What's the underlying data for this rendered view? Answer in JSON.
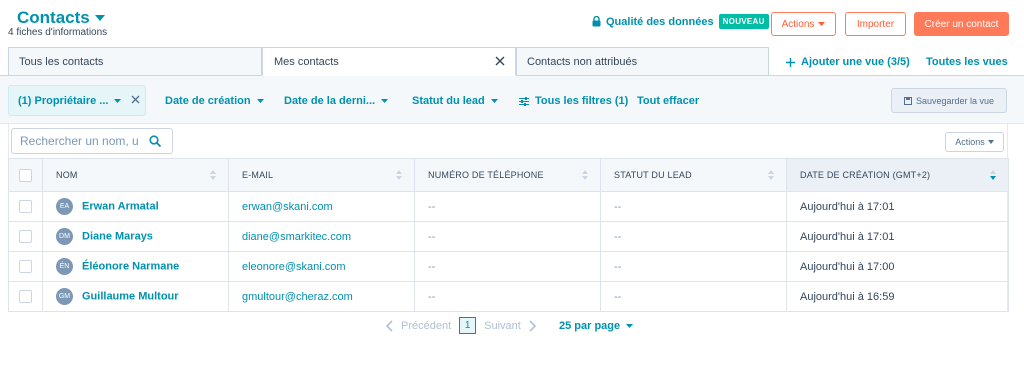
{
  "header": {
    "title": "Contacts",
    "subtitle": "4 fiches d'informations",
    "data_quality": "Qualité des données",
    "new_badge": "NOUVEAU",
    "actions_label": "Actions",
    "import_label": "Importer",
    "create_label": "Créer un contact"
  },
  "tabs": [
    {
      "label": "Tous les contacts"
    },
    {
      "label": "Mes contacts",
      "active": true
    },
    {
      "label": "Contacts non attribués"
    }
  ],
  "views": {
    "add_view": "Ajouter une vue (3/5)",
    "all_views": "Toutes les vues"
  },
  "filters": {
    "owner": "(1) Propriétaire ...",
    "created": "Date de création",
    "last": "Date de la derni...",
    "lead_status": "Statut du lead",
    "all_filters": "Tous les filtres (1)",
    "clear_all": "Tout effacer",
    "save_view": "Sauvegarder la vue"
  },
  "search": {
    "placeholder": "Rechercher un nom, u"
  },
  "table": {
    "actions_label": "Actions",
    "columns": [
      "NOM",
      "E-MAIL",
      "NUMÉRO DE TÉLÉPHONE",
      "STATUT DU LEAD",
      "DATE DE CRÉATION (GMT+2)"
    ],
    "rows": [
      {
        "initials": "EA",
        "name": "Erwan Armatal",
        "email": "erwan@skani.com",
        "phone": "--",
        "status": "--",
        "created": "Aujourd'hui à 17:01"
      },
      {
        "initials": "DM",
        "name": "Diane Marays",
        "email": "diane@smarkitec.com",
        "phone": "--",
        "status": "--",
        "created": "Aujourd'hui à 17:01"
      },
      {
        "initials": "ÉN",
        "name": "Éléonore Narmane",
        "email": "eleonore@skani.com",
        "phone": "--",
        "status": "--",
        "created": "Aujourd'hui à 17:00"
      },
      {
        "initials": "GM",
        "name": "Guillaume Multour",
        "email": "gmultour@cheraz.com",
        "phone": "--",
        "status": "--",
        "created": "Aujourd'hui à 16:59"
      }
    ]
  },
  "pagination": {
    "previous": "Précédent",
    "page": "1",
    "next": "Suivant",
    "per_page": "25 par page"
  },
  "colors": {
    "accent": "#0091ae",
    "primary_button": "#ff7a59",
    "badge": "#00bda5"
  }
}
